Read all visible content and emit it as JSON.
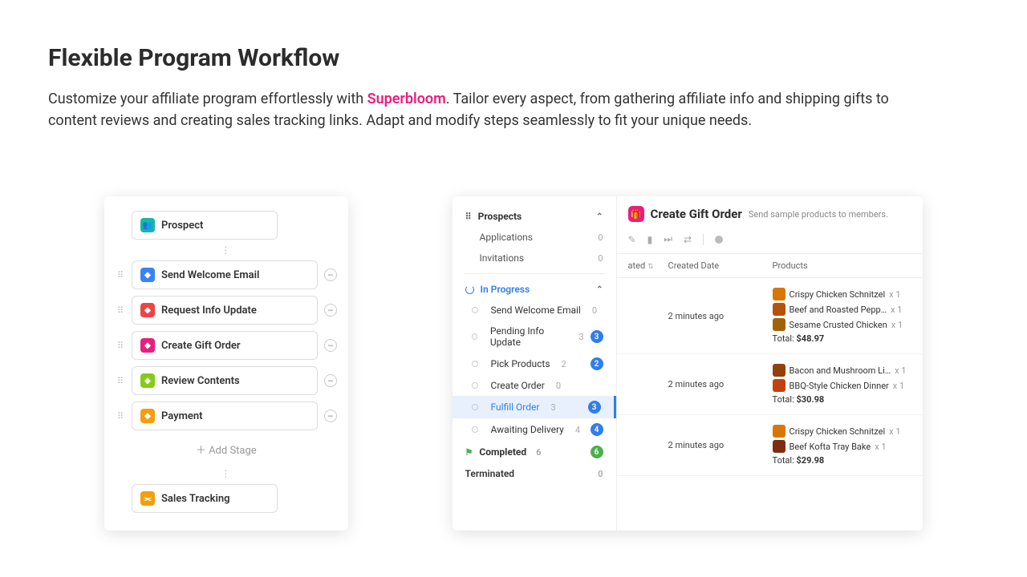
{
  "hero": {
    "title": "Flexible Program Workflow",
    "desc1": "Customize your affiliate program effortlessly with ",
    "brand": "Superbloom",
    "desc2": ". Tailor every aspect, from gathering affiliate info and shipping gifts to content reviews and creating sales tracking links. Adapt and modify steps seamlessly to fit your unique needs."
  },
  "workflow": {
    "prospect": "Prospect",
    "stages": [
      {
        "label": "Send Welcome Email",
        "color": "#3b82f6"
      },
      {
        "label": "Request Info Update",
        "color": "#ef4444"
      },
      {
        "label": "Create Gift Order",
        "color": "#e91e7e"
      },
      {
        "label": "Review Contents",
        "color": "#84cc16"
      },
      {
        "label": "Payment",
        "color": "#f59e0b"
      }
    ],
    "add": "Add Stage",
    "tracking": "Sales Tracking",
    "tracking_color": "#f59e0b"
  },
  "nav": {
    "prospects": "Prospects",
    "applications": "Applications",
    "app_ct": "0",
    "invitations": "Invitations",
    "inv_ct": "0",
    "inprogress": "In Progress",
    "steps": [
      {
        "label": "Send Welcome Email",
        "ct": "0"
      },
      {
        "label": "Pending Info Update",
        "ct": "3",
        "badge": "3"
      },
      {
        "label": "Pick Products",
        "ct": "2",
        "badge": "2"
      },
      {
        "label": "Create Order",
        "ct": "0"
      },
      {
        "label": "Fulfill Order",
        "ct": "3",
        "badge": "3",
        "sel": true
      },
      {
        "label": "Awaiting Delivery",
        "ct": "4",
        "badge": "4"
      }
    ],
    "completed": "Completed",
    "comp_ct": "6",
    "comp_badge": "6",
    "terminated": "Terminated",
    "term_ct": "0"
  },
  "main": {
    "title": "Create Gift Order",
    "sub": "Send sample products to members.",
    "cols": {
      "c1": "ated",
      "c2": "Created Date",
      "c3": "Products"
    },
    "rows": [
      {
        "date": "2 minutes ago",
        "products": [
          {
            "name": "Crispy Chicken Schnitzel",
            "qty": "x 1",
            "c": "#d97706"
          },
          {
            "name": "Beef and Roasted Pepp…",
            "qty": "x 1",
            "c": "#b45309"
          },
          {
            "name": "Sesame Crusted Chicken",
            "qty": "x 1",
            "c": "#a16207"
          }
        ],
        "total": "$48.97"
      },
      {
        "date": "2 minutes ago",
        "products": [
          {
            "name": "Bacon and Mushroom Li…",
            "qty": "x 1",
            "c": "#92400e"
          },
          {
            "name": "BBQ-Style Chicken Dinner",
            "qty": "x 1",
            "c": "#c2410c"
          }
        ],
        "total": "$30.98"
      },
      {
        "date": "2 minutes ago",
        "products": [
          {
            "name": "Crispy Chicken Schnitzel",
            "qty": "x 1",
            "c": "#d97706"
          },
          {
            "name": "Beef Kofta Tray Bake",
            "qty": "x 1",
            "c": "#7c2d12"
          }
        ],
        "total": "$29.98"
      }
    ],
    "total_label": "Total: "
  }
}
